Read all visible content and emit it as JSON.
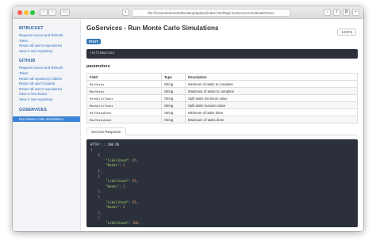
{
  "browser": {
    "url": "file:///Users/emmetto/Desktop/apidoc/index.html#api-GoServices-EstimatePrazo"
  },
  "sidebar": {
    "groups": [
      {
        "title": "BITBUCKET",
        "items": [
          "Request Access and Refresh",
          "Token",
          "Return all user's repositories",
          "Save a new repository"
        ]
      },
      {
        "title": "GITHUB",
        "items": [
          "Request Access and Refresh",
          "Token",
          "Return all repository's labels",
          "Return all user's boards",
          "Return all user's repositories",
          "Save a new board",
          "Save a new repository"
        ]
      },
      {
        "title": "GOSERVICES",
        "items": [
          "Run Monte Carlo Simulations"
        ]
      }
    ]
  },
  "main": {
    "title": "GoServices - Run Monte Carlo Simulations",
    "version": "1.0.0 ▾",
    "method": "POST",
    "endpoint": "/estimeprazo",
    "params_heading": "parameters",
    "table": {
      "headers": [
        "Field",
        "Type",
        "Description"
      ],
      "rows": [
        [
          "MinTasks",
          "String",
          "Minimum of tasks to complete"
        ],
        [
          "MaxTasks",
          "String",
          "Maximum of tasks to complete"
        ],
        [
          "MinSplitTasks",
          "String",
          "Split tasks minimum value"
        ],
        [
          "MaxSplitTasks",
          "String",
          "Split tasks maxium value"
        ],
        [
          "MinTasksDone",
          "String",
          "Minimum of tasks done"
        ],
        [
          "MaxTasksDone",
          "String",
          "Maximum of tasks done"
        ]
      ]
    },
    "tab_label": "Success-Response:",
    "response": {
      "status_line": [
        "HTTP/",
        "1.1",
        " 200 OK"
      ],
      "entries": [
        {
          "likelihood": "95",
          "weeks": "3"
        },
        {
          "likelihood": "95",
          "weeks": "3"
        },
        {
          "likelihood": "95",
          "weeks": "3"
        }
      ],
      "last_likelihood": "100"
    }
  }
}
